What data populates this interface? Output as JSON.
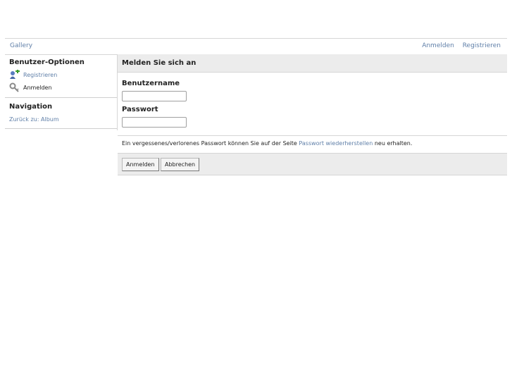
{
  "header": {
    "brand": "Gallery",
    "login_link": "Anmelden",
    "register_link": "Registrieren"
  },
  "sidebar": {
    "user_options_title": "Benutzer-Optionen",
    "register_label": "Registrieren",
    "login_label": "Anmelden",
    "navigation_title": "Navigation",
    "back_link": "Zurück zu: Album"
  },
  "main": {
    "title": "Melden Sie sich an",
    "username_label": "Benutzername",
    "username_value": "",
    "password_label": "Passwort",
    "password_value": "",
    "note_prefix": "Ein vergessenes/verlorenes Passwort können Sie auf der Seite",
    "note_link": "Passwort wiederherstellen",
    "note_suffix": "neu erhalten.",
    "login_button": "Anmelden",
    "cancel_button": "Abbrechen"
  },
  "colors": {
    "link": "#5f7fa8",
    "panel_bg": "#ececec",
    "border": "#d6d6d6"
  },
  "icons": {
    "register": "user-add-icon",
    "login": "key-icon"
  }
}
